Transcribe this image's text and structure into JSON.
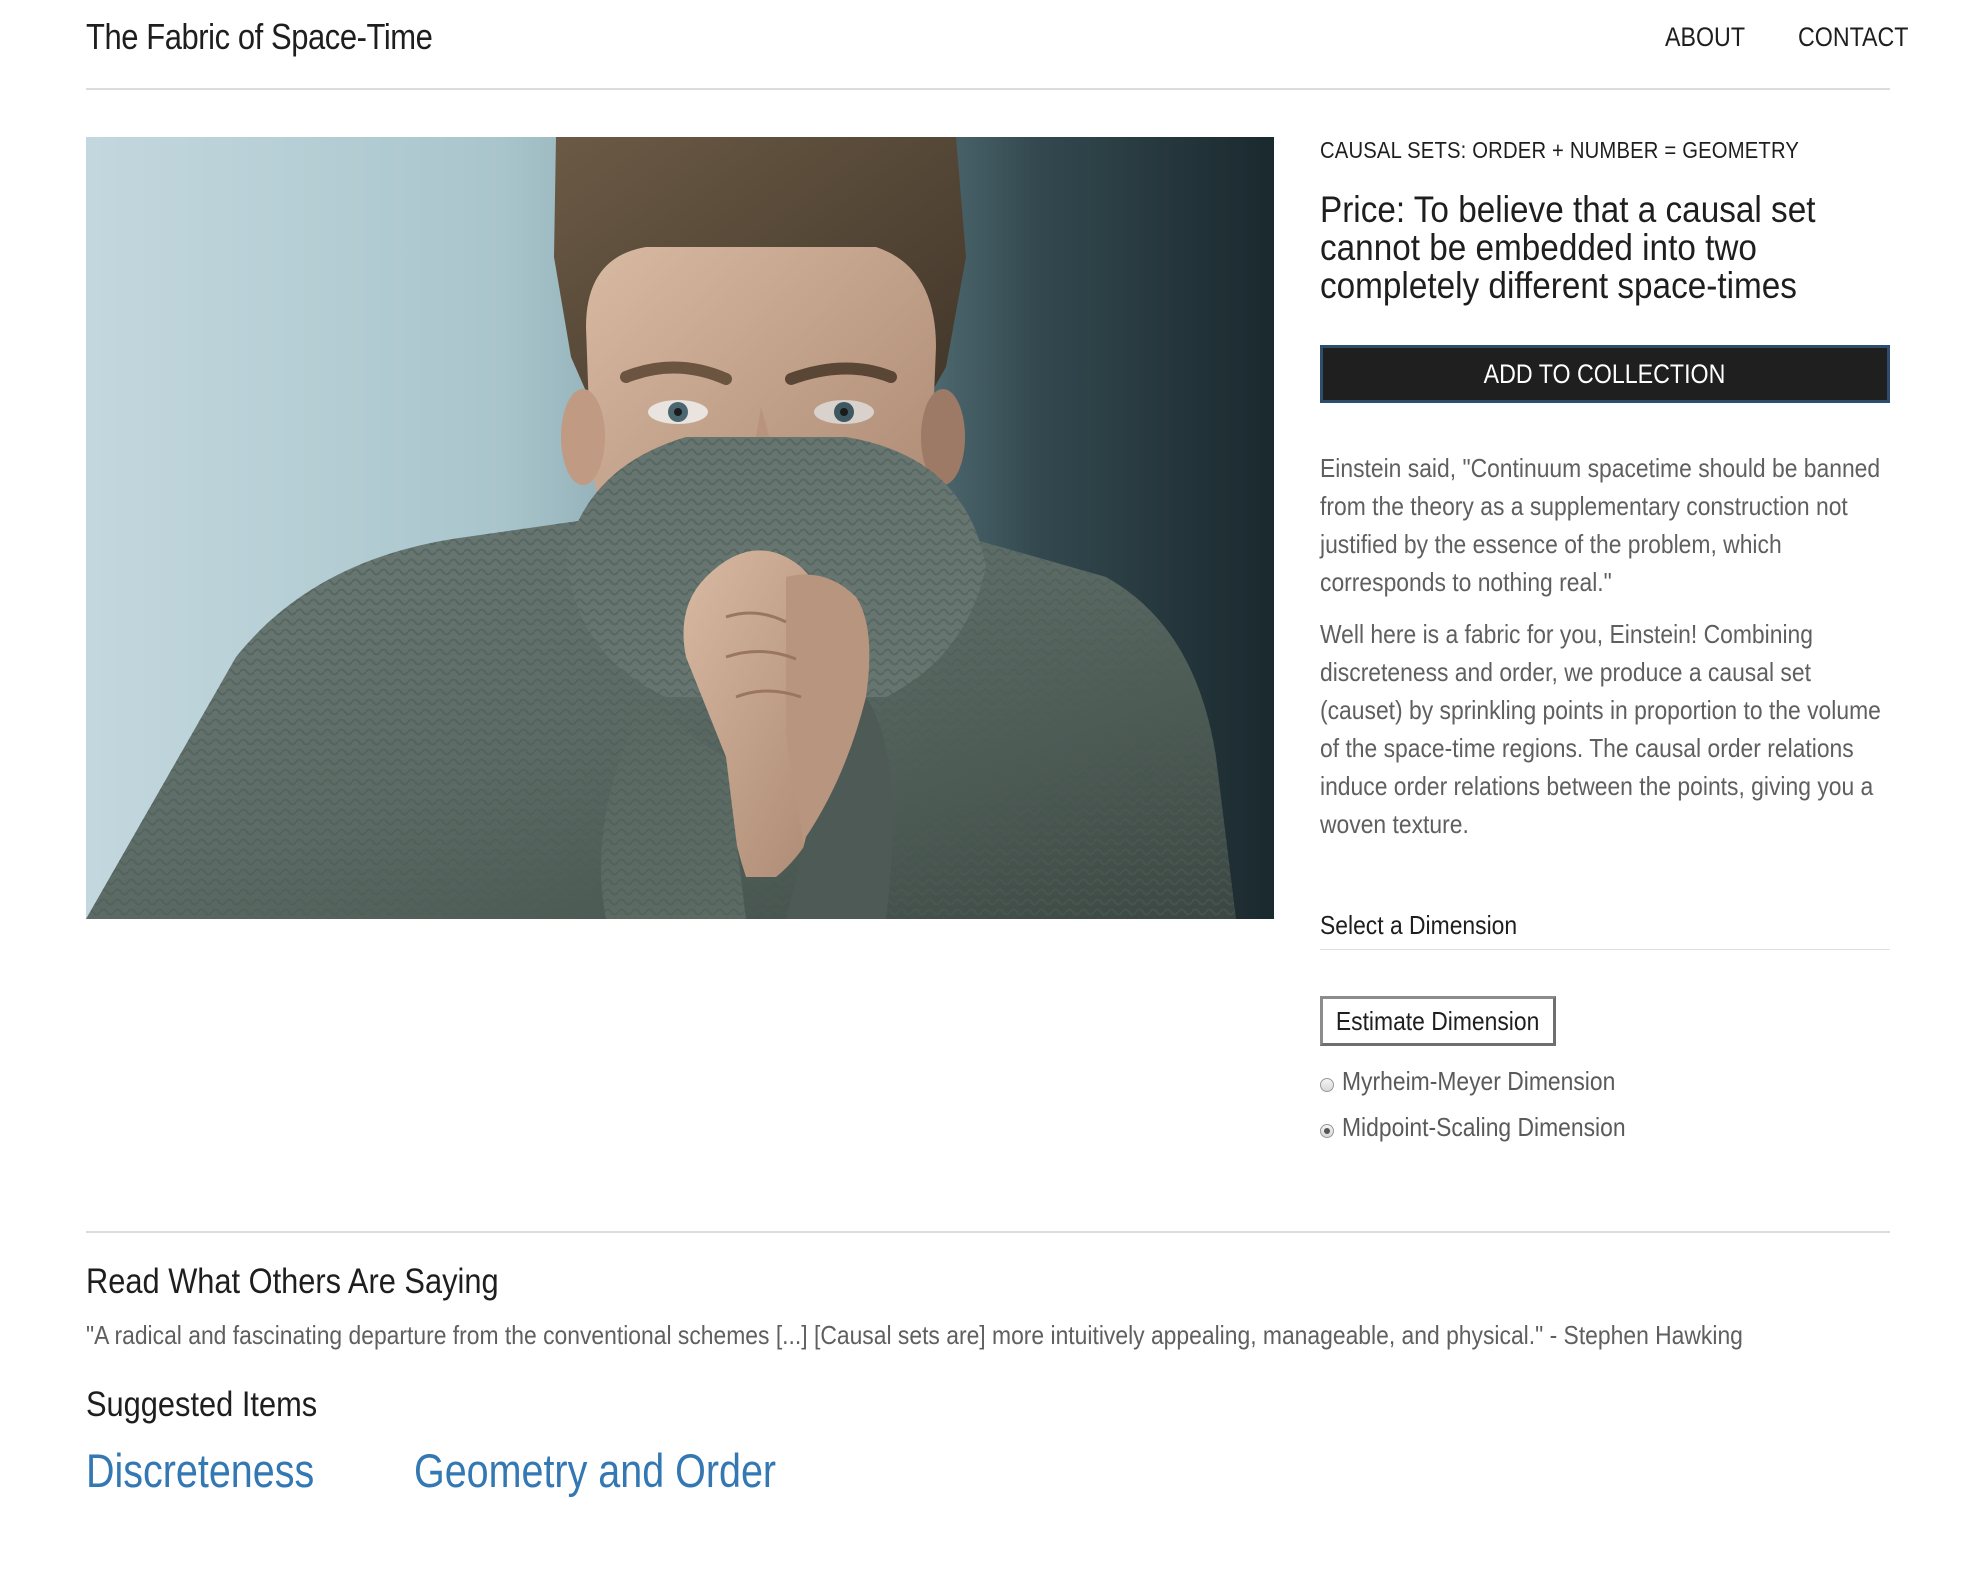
{
  "header": {
    "site_title": "The Fabric of Space-Time",
    "nav": [
      "ABOUT",
      "CONTACT"
    ]
  },
  "product": {
    "image_alt": "Man in a grey knit turtleneck sweater pulling the collar up over his face",
    "subtitle": "CAUSAL SETS: ORDER + NUMBER = GEOMETRY",
    "price": "Price: To believe that a causal set cannot be embedded into two completely different space-times",
    "add_button": "ADD TO COLLECTION",
    "description": [
      "Einstein said, \"Continuum spacetime should be banned from the theory as a supplementary construction not justified by the essence of the problem, which corresponds to nothing real.\"",
      "Well here is a fabric for you, Einstein! Combining discreteness and order, we produce a causal set (causet) by sprinkling points in proportion to the volume of the space-time regions. The causal order relations induce order relations between the points, giving you a woven texture."
    ]
  },
  "dimension": {
    "label": "Select a Dimension",
    "estimate_button": "Estimate Dimension",
    "options": [
      {
        "label": "Myrheim-Meyer Dimension",
        "checked": false
      },
      {
        "label": "Midpoint-Scaling Dimension",
        "checked": true
      }
    ]
  },
  "reviews": {
    "title": "Read What Others Are Saying",
    "quote": "\"A radical and fascinating departure from the conventional schemes [...] [Causal sets are] more intuitively appealing, manageable, and physical.\" - Stephen Hawking"
  },
  "suggested": {
    "title": "Suggested Items",
    "items": [
      "Discreteness",
      "Geometry and Order"
    ]
  },
  "colors": {
    "link": "#3377b3",
    "button_bg": "#1f1f1f",
    "button_border": "#2d4d6d",
    "body_text": "#5f5f5f",
    "rule": "#dcdcdc"
  }
}
